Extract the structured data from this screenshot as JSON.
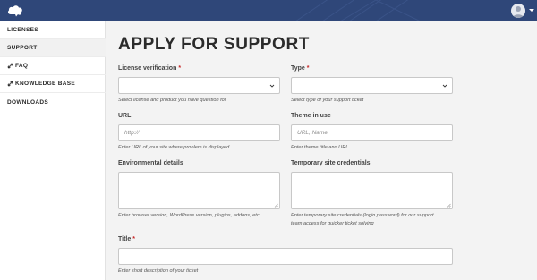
{
  "sidebar": {
    "items": [
      {
        "label": "LICENSES"
      },
      {
        "label": "SUPPORT"
      },
      {
        "label": "FAQ"
      },
      {
        "label": "KNOWLEDGE BASE"
      },
      {
        "label": "DOWNLOADS"
      }
    ]
  },
  "page": {
    "title": "APPLY FOR SUPPORT"
  },
  "form": {
    "license": {
      "label": "License verification",
      "required": "*",
      "help": "Select license and product you have question for"
    },
    "type": {
      "label": "Type",
      "required": "*",
      "help": "Select type of your support ticket"
    },
    "url": {
      "label": "URL",
      "placeholder": "http://",
      "help": "Enter URL of your site where problem is displayed"
    },
    "theme": {
      "label": "Theme in use",
      "placeholder": "URL, Name",
      "help": "Enter theme title and URL"
    },
    "env": {
      "label": "Environmental details",
      "help": "Enter browser version, WordPress version, plugins, addons, etc"
    },
    "creds": {
      "label": "Temporary site credentials",
      "help_line1": "Enter temporary site credentials (login password) for our support",
      "help_line2": "team access for quicker ticket solving"
    },
    "title": {
      "label": "Title",
      "required": "*",
      "help": "Enter short description of your ticket"
    }
  },
  "colors": {
    "topbar": "#2f4779",
    "page_bg": "#f3f3f3",
    "required": "#c62828"
  },
  "icons": {
    "logo": "cloud-logo-icon",
    "avatar": "user-avatar-icon",
    "link": "link-icon",
    "chevron": "chevron-down-icon"
  }
}
